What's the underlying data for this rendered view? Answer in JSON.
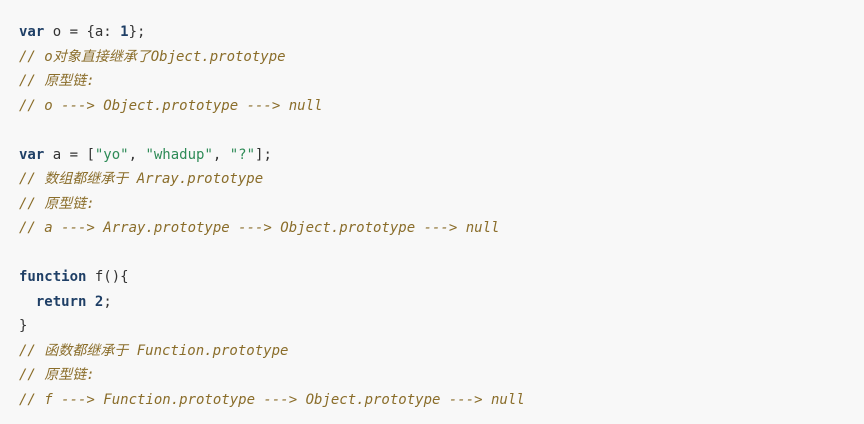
{
  "code": {
    "lines": [
      [
        {
          "t": "var",
          "c": "kw"
        },
        {
          "t": " o = ",
          "c": "ident"
        },
        {
          "t": "{a: ",
          "c": "pun"
        },
        {
          "t": "1",
          "c": "num"
        },
        {
          "t": "};",
          "c": "pun"
        }
      ],
      [
        {
          "t": "// o对象直接继承了Object.prototype",
          "c": "cmt"
        }
      ],
      [
        {
          "t": "// 原型链:",
          "c": "cmt"
        }
      ],
      [
        {
          "t": "// o ---> Object.prototype ---> null",
          "c": "cmt"
        }
      ],
      [],
      [
        {
          "t": "var",
          "c": "kw"
        },
        {
          "t": " a = [",
          "c": "ident"
        },
        {
          "t": "\"yo\"",
          "c": "str"
        },
        {
          "t": ", ",
          "c": "pun"
        },
        {
          "t": "\"whadup\"",
          "c": "str"
        },
        {
          "t": ", ",
          "c": "pun"
        },
        {
          "t": "\"?\"",
          "c": "str"
        },
        {
          "t": "];",
          "c": "pun"
        }
      ],
      [
        {
          "t": "// 数组都继承于 Array.prototype",
          "c": "cmt"
        }
      ],
      [
        {
          "t": "// 原型链:",
          "c": "cmt"
        }
      ],
      [
        {
          "t": "// a ---> Array.prototype ---> Object.prototype ---> null",
          "c": "cmt"
        }
      ],
      [],
      [
        {
          "t": "function",
          "c": "kw"
        },
        {
          "t": " f(){",
          "c": "ident"
        }
      ],
      [
        {
          "t": "  ",
          "c": "ident"
        },
        {
          "t": "return",
          "c": "kw"
        },
        {
          "t": " ",
          "c": "ident"
        },
        {
          "t": "2",
          "c": "num"
        },
        {
          "t": ";",
          "c": "pun"
        }
      ],
      [
        {
          "t": "}",
          "c": "pun"
        }
      ],
      [
        {
          "t": "// 函数都继承于 Function.prototype",
          "c": "cmt"
        }
      ],
      [
        {
          "t": "// 原型链:",
          "c": "cmt"
        }
      ],
      [
        {
          "t": "// f ---> Function.prototype ---> Object.prototype ---> null",
          "c": "cmt"
        }
      ]
    ]
  },
  "colors": {
    "background": "#f8f8f8",
    "keyword": "#1f3f66",
    "string": "#2e8b57",
    "comment": "#8a6d2a"
  }
}
